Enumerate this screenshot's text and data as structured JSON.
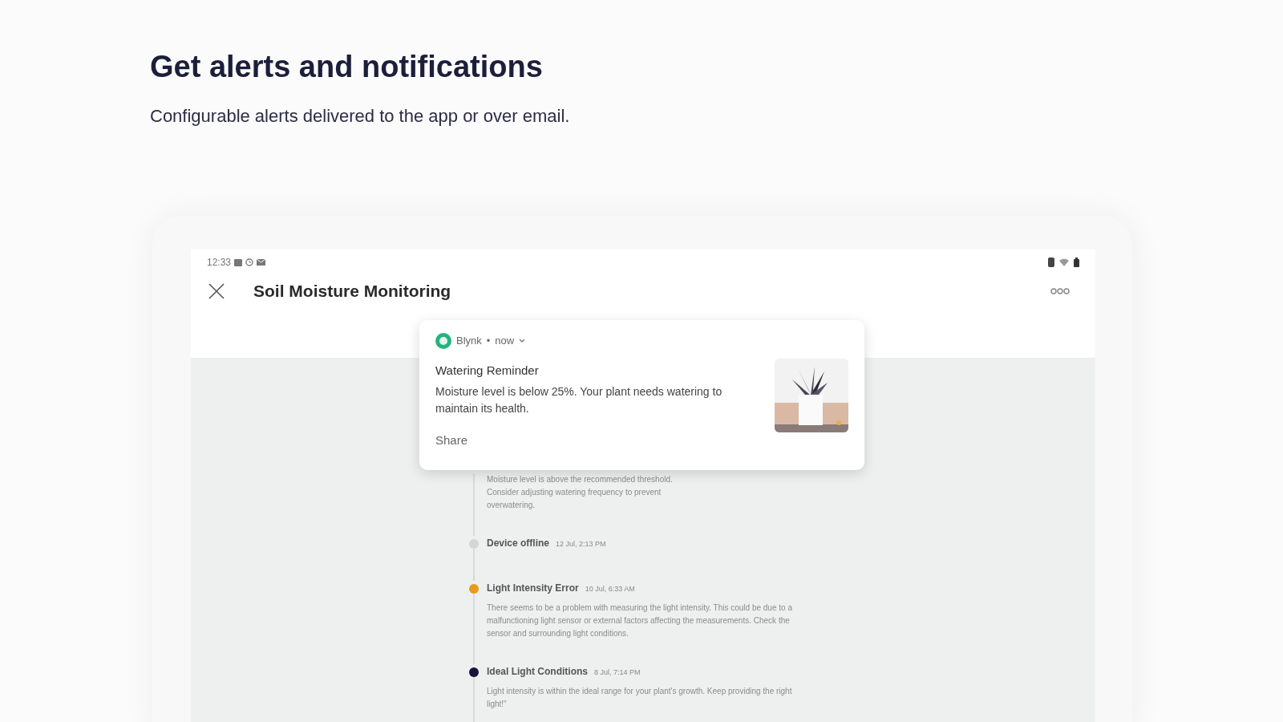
{
  "heading": "Get alerts and notifications",
  "subheading": "Configurable alerts delivered to the app or over email.",
  "status_bar": {
    "time": "12:33"
  },
  "app_bar": {
    "title": "Soil Moisture Monitoring"
  },
  "notification": {
    "app": "Blynk",
    "separator": "•",
    "time": "now",
    "title": "Watering Reminder",
    "body": "Moisture level is below 25%. Your plant needs watering to maintain its health.",
    "action": "Share"
  },
  "timeline": [
    {
      "description": "Moisture level is above the recommended threshold. Consider adjusting watering frequency to prevent overwatering."
    },
    {
      "title": "Device offline",
      "time": "12 Jul, 2:13 PM",
      "color": "#d4d6d6"
    },
    {
      "title": "Light Intensity Error",
      "time": "10 Jul, 6:33 AM",
      "color": "#e89a1c",
      "description": "There seems to be a problem with measuring the light intensity. This could be due to a malfunctioning light sensor or external factors affecting the measurements. Check the sensor and surrounding light conditions."
    },
    {
      "title": "Ideal Light Conditions",
      "time": "8 Jul, 7:14 PM",
      "color": "#14143c",
      "description": "Light intensity is within the ideal range for your plant's growth. Keep providing the right light!\""
    }
  ]
}
